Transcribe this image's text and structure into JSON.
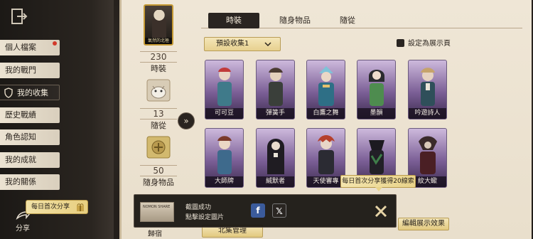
{
  "sidebar": {
    "items": [
      {
        "label": "個人檔案"
      },
      {
        "label": "我的戰門"
      },
      {
        "label": "我的收集"
      },
      {
        "label": "歷史戰績"
      },
      {
        "label": "角色認知"
      },
      {
        "label": "我的成就"
      },
      {
        "label": "我的關係"
      }
    ],
    "share_label": "分享",
    "share_tip": "每日首次分享"
  },
  "stats": {
    "portrait_label": "氣然的北極",
    "costume_count": "230",
    "costume_label": "時裝",
    "pet_count": "13",
    "pet_label": "隨從",
    "item_count": "50",
    "item_label": "隨身物品",
    "bottom_partial": "歸宿"
  },
  "tabs": [
    {
      "label": "時裝"
    },
    {
      "label": "隨身物品"
    },
    {
      "label": "隨從"
    }
  ],
  "dropdown": {
    "value": "預設收集1"
  },
  "display_toggle": {
    "label": "設定為展示頁"
  },
  "cards": [
    {
      "name": "可可豆"
    },
    {
      "name": "彈簧手"
    },
    {
      "name": "白鷹之舞"
    },
    {
      "name": "墨韻"
    },
    {
      "name": "吟遊詩人"
    },
    {
      "name": "大師牌"
    },
    {
      "name": "緘默者"
    },
    {
      "name": "天使審專"
    },
    {
      "name": ""
    },
    {
      "name": "紋大蠍"
    }
  ],
  "tooltip": "每日首次分享獲得20線索",
  "bottom_buttons": {
    "collect": "北集管理",
    "edit": "編輯展示效果"
  },
  "toast": {
    "line1": "截圖成功",
    "line2": "點擊設定圖片",
    "thumb_text": "NOMON SHARE"
  },
  "colors": {
    "paper": "#efe6d6",
    "dark_tab": "#2a2521",
    "gold": "#e9d38a",
    "card_purple": "#7b5f96"
  }
}
